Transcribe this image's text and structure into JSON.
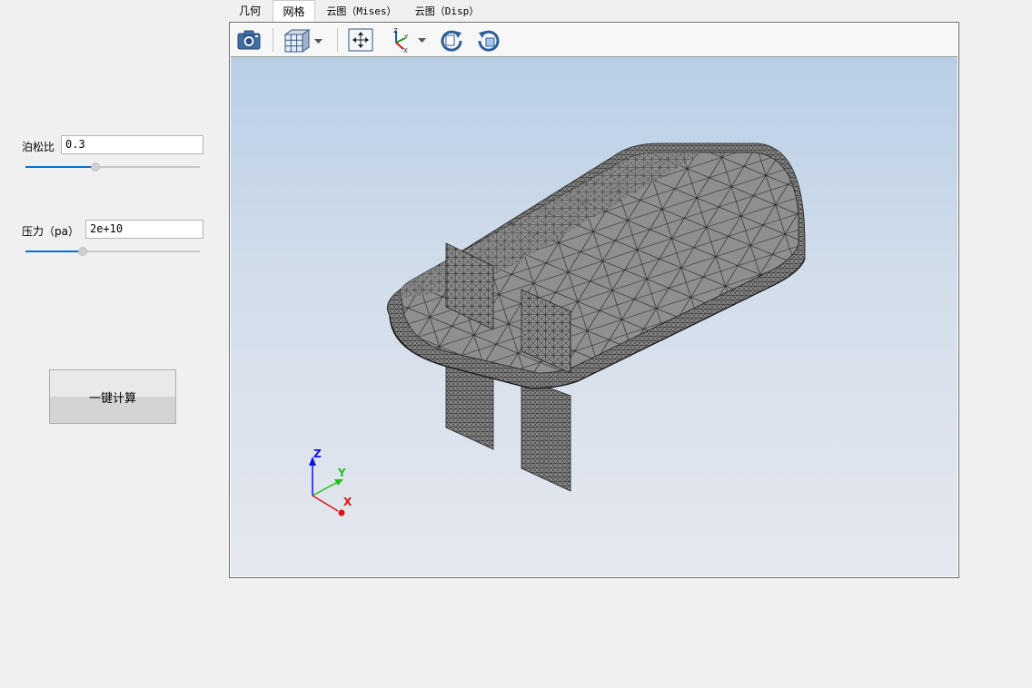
{
  "params": {
    "poisson": {
      "label": "泊松比",
      "value": "0.3",
      "slider": 0.4
    },
    "pressure": {
      "label": "压力（pa）",
      "value": "2e+10",
      "slider": 0.33
    }
  },
  "actions": {
    "calculate_label": "一键计算"
  },
  "tabs": [
    {
      "label": "几何",
      "active": false
    },
    {
      "label": "网格",
      "active": true
    },
    {
      "label": "云图（Mises）",
      "active": false
    },
    {
      "label": "云图（Disp）",
      "active": false
    }
  ],
  "toolbar": [
    "camera-icon",
    "view-cube-icon",
    "fit-view-icon",
    "axes-icon",
    "rotate-cw-icon",
    "rotate-ccw-icon"
  ],
  "axes": {
    "x": "X",
    "y": "Y",
    "z": "Z",
    "colors": {
      "x": "#e01010",
      "y": "#1cc31c",
      "z": "#1010e0"
    }
  },
  "colors": {
    "slider_fill": "#0f6fc6",
    "mesh_face": "#8c8c8c",
    "mesh_line": "#1a1a1a"
  }
}
